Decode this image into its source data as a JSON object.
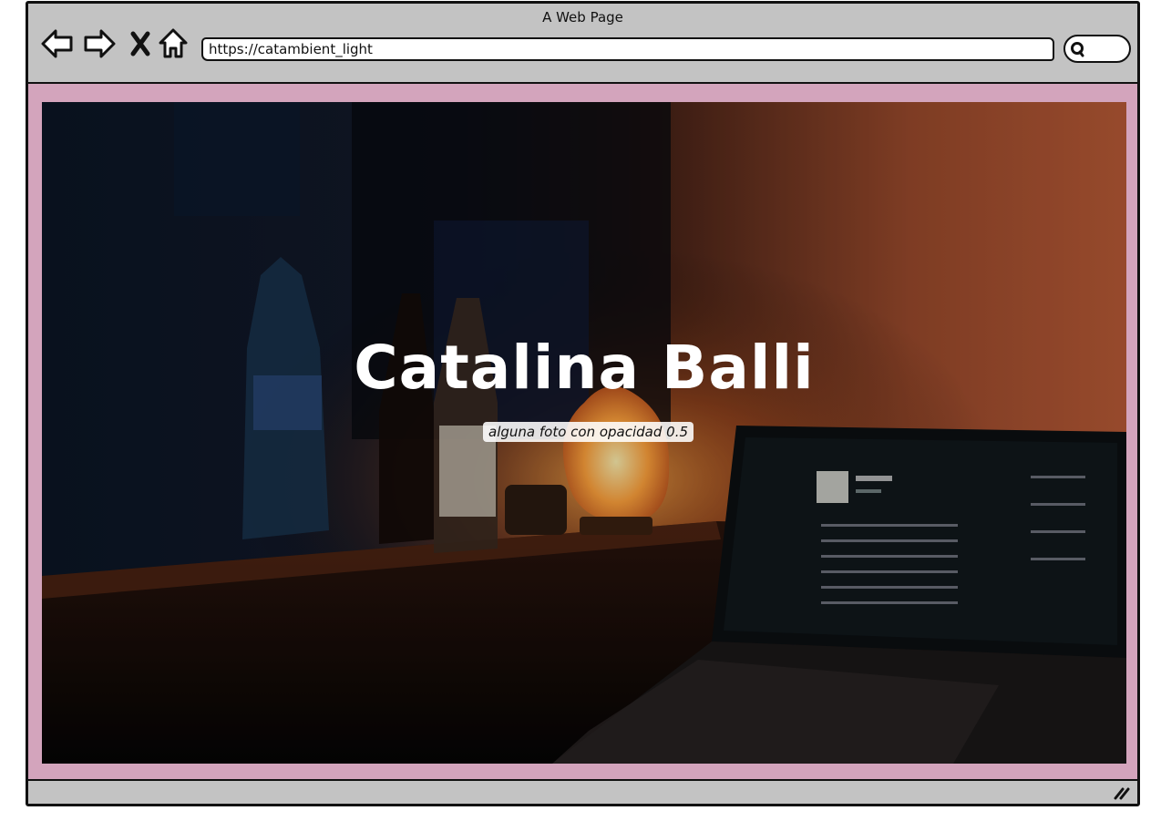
{
  "window": {
    "title": "A Web Page"
  },
  "toolbar": {
    "back_icon": "back-arrow-icon",
    "forward_icon": "forward-arrow-icon",
    "stop_icon": "close-x-icon",
    "home_icon": "home-icon",
    "url": "https://catambient_light",
    "search_icon": "search-icon"
  },
  "hero": {
    "title": "Catalina Balli",
    "caption": "alguna foto con opacidad 0.5",
    "image_subject": "dim room with lamp, bottles and laptop"
  },
  "colors": {
    "chrome": "#c3c3c3",
    "page_background": "#d3a4bc",
    "hero_text": "#ffffff"
  }
}
